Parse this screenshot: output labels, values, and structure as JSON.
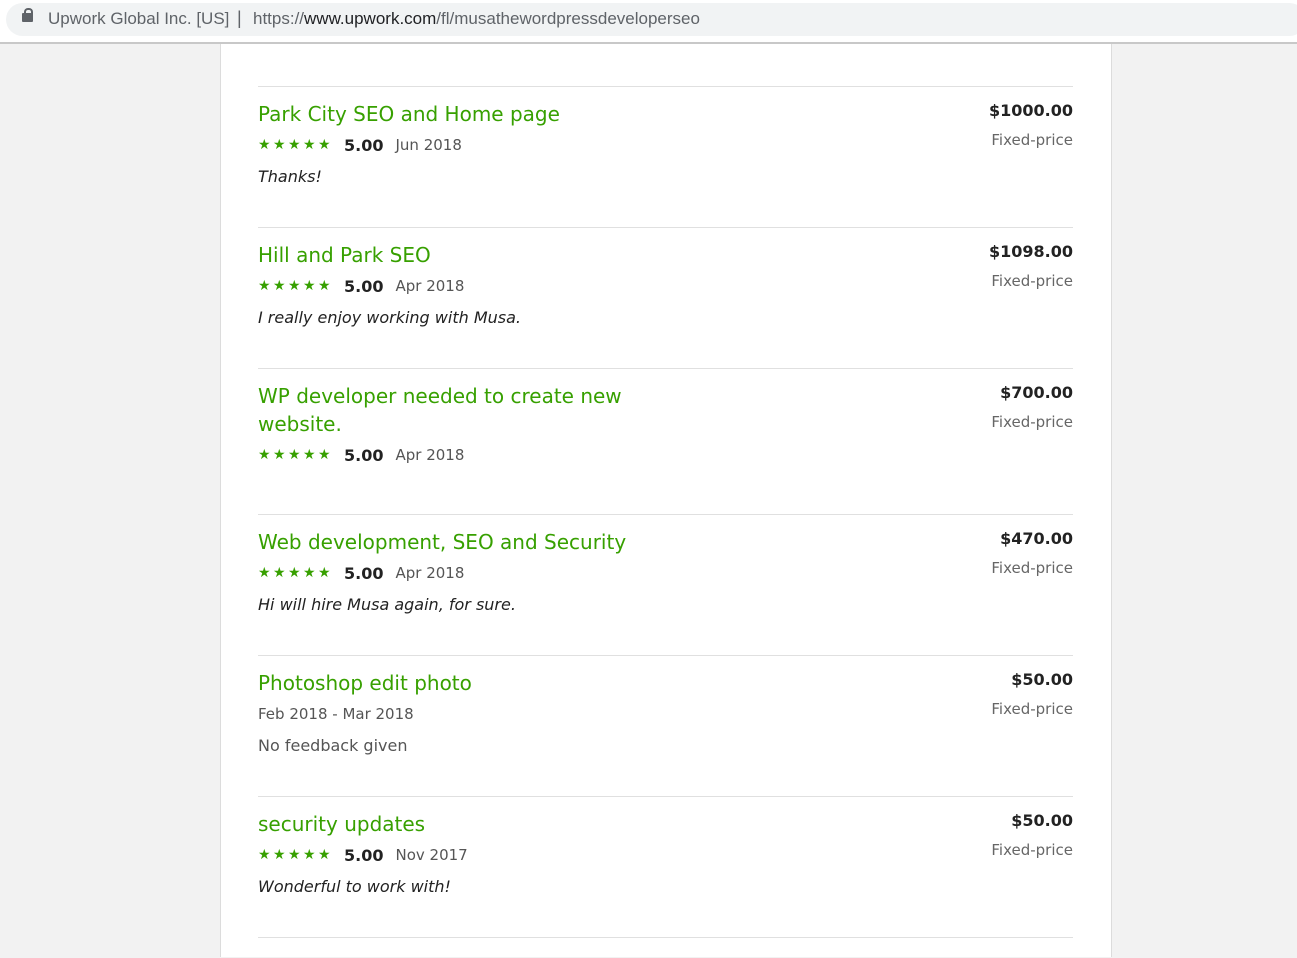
{
  "browser": {
    "site_name": "Upwork Global Inc. [US]",
    "separator": "|",
    "url_scheme": "https://",
    "url_host": "www.upwork.com",
    "url_path": "/fl/musathewordpressdeveloperseo"
  },
  "jobs": [
    {
      "title": "Park City SEO and Home page",
      "rating": "5.00",
      "date": "Jun 2018",
      "feedback": "Thanks!",
      "amount": "$1000.00",
      "type": "Fixed-price",
      "stars": 5
    },
    {
      "title": "Hill and Park SEO",
      "rating": "5.00",
      "date": "Apr 2018",
      "feedback": "I really enjoy working with Musa.",
      "amount": "$1098.00",
      "type": "Fixed-price",
      "stars": 5
    },
    {
      "title": "WP developer needed to create new website.",
      "rating": "5.00",
      "date": "Apr 2018",
      "feedback": "",
      "amount": "$700.00",
      "type": "Fixed-price",
      "stars": 5
    },
    {
      "title": "Web development, SEO and Security",
      "rating": "5.00",
      "date": "Apr 2018",
      "feedback": "Hi will hire Musa again, for sure.",
      "amount": "$470.00",
      "type": "Fixed-price",
      "stars": 5
    },
    {
      "title": "Photoshop edit photo",
      "date_range": "Feb 2018 - Mar 2018",
      "no_feedback": "No feedback given",
      "amount": "$50.00",
      "type": "Fixed-price"
    },
    {
      "title": "security updates",
      "rating": "5.00",
      "date": "Nov 2017",
      "feedback": "Wonderful to work with!",
      "amount": "$50.00",
      "type": "Fixed-price",
      "stars": 5
    }
  ],
  "colors": {
    "accent": "#37a000",
    "text": "#222222",
    "muted": "#666666"
  }
}
